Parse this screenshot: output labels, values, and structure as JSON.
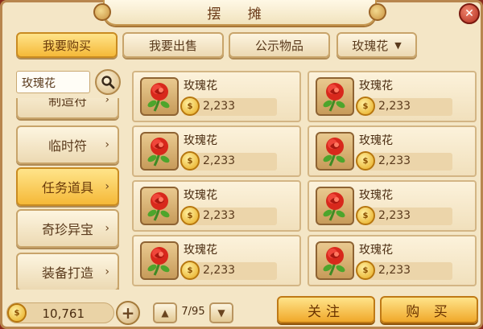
{
  "window": {
    "title": "摆 摊",
    "close_icon": "close-icon"
  },
  "tabs": [
    {
      "label": "我要购买",
      "active": true
    },
    {
      "label": "我要出售",
      "active": false
    },
    {
      "label": "公示物品",
      "active": false
    }
  ],
  "filter": {
    "selected": "玫瑰花",
    "icon": "dropdown-arrow-icon"
  },
  "search": {
    "value": "玫瑰花",
    "icon": "search-icon"
  },
  "categories": [
    {
      "label": "制造符",
      "active": false
    },
    {
      "label": "临时符",
      "active": false
    },
    {
      "label": "任务道具",
      "active": true
    },
    {
      "label": "奇珍异宝",
      "active": false
    },
    {
      "label": "装备打造",
      "active": false
    }
  ],
  "items": [
    {
      "name": "玫瑰花",
      "price": "2,233",
      "icon": "rose-icon"
    },
    {
      "name": "玫瑰花",
      "price": "2,233",
      "icon": "rose-icon"
    },
    {
      "name": "玫瑰花",
      "price": "2,233",
      "icon": "rose-icon"
    },
    {
      "name": "玫瑰花",
      "price": "2,233",
      "icon": "rose-icon"
    },
    {
      "name": "玫瑰花",
      "price": "2,233",
      "icon": "rose-icon"
    },
    {
      "name": "玫瑰花",
      "price": "2,233",
      "icon": "rose-icon"
    },
    {
      "name": "玫瑰花",
      "price": "2,233",
      "icon": "rose-icon"
    },
    {
      "name": "玫瑰花",
      "price": "2,233",
      "icon": "rose-icon"
    }
  ],
  "footer": {
    "money": "10,761",
    "page": "7/95",
    "follow_label": "关注",
    "buy_label": "购 买"
  },
  "colors": {
    "accent_gold": "#f5b938",
    "panel_bg": "#f4e6c6",
    "text_brown": "#5a3a1c"
  }
}
